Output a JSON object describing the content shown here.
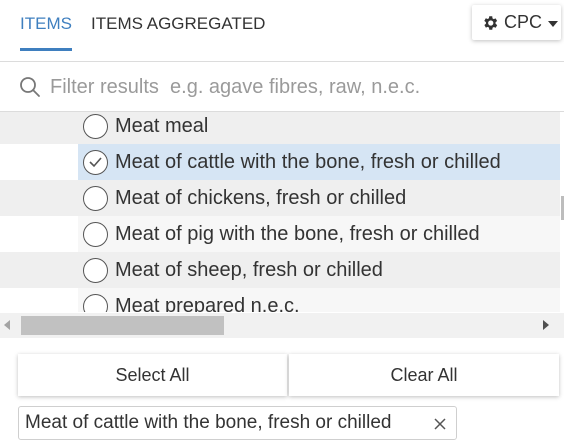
{
  "tabs": [
    {
      "label": "ITEMS",
      "active": true
    },
    {
      "label": "ITEMS AGGREGATED",
      "active": false
    }
  ],
  "classification_button": {
    "label": "CPC",
    "icon": "gear-icon"
  },
  "filter": {
    "placeholder": "Filter results  e.g. agave fibres, raw, n.e.c.",
    "value": ""
  },
  "list": {
    "items": [
      {
        "label": "Meat meal",
        "selected": false
      },
      {
        "label": "Meat of cattle with the bone, fresh or chilled",
        "selected": true
      },
      {
        "label": "Meat of chickens, fresh or chilled",
        "selected": false
      },
      {
        "label": "Meat of pig with the bone, fresh or chilled",
        "selected": false
      },
      {
        "label": "Meat of sheep, fresh or chilled",
        "selected": false
      },
      {
        "label": "Meat prepared n.e.c.",
        "selected": false
      }
    ]
  },
  "actions": {
    "select_all": "Select All",
    "clear_all": "Clear All"
  },
  "selected_chips": [
    {
      "label": "Meat of cattle with the bone, fresh or chilled"
    }
  ],
  "colors": {
    "accent": "#3f7fbf",
    "selected_row": "#d6e5f4"
  }
}
